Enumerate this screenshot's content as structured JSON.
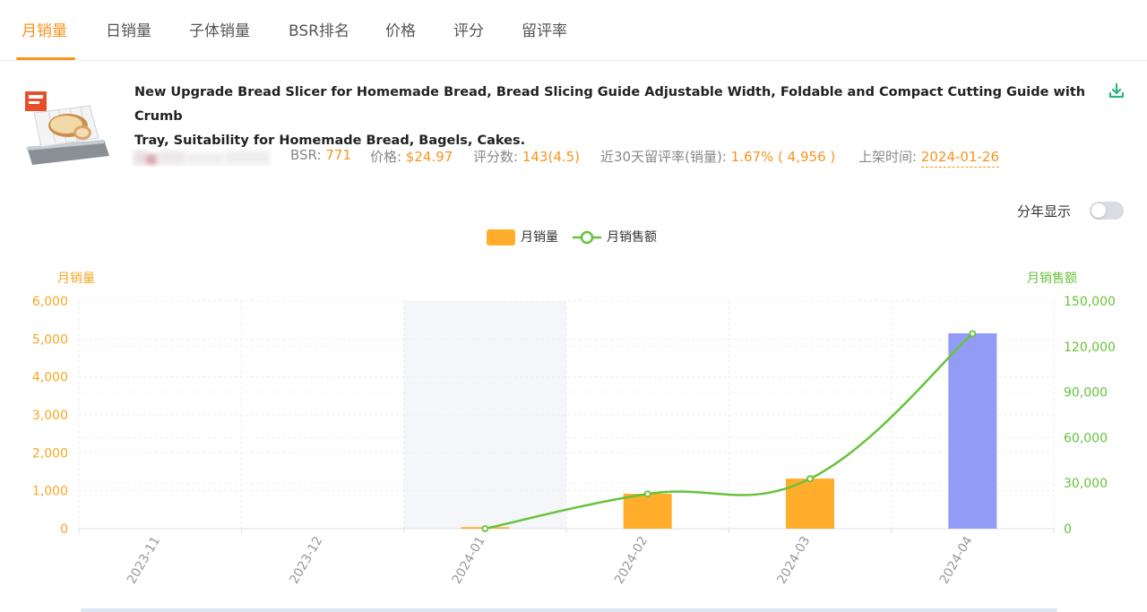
{
  "tabs": [
    {
      "label": "月销量",
      "active": true
    },
    {
      "label": "日销量",
      "active": false
    },
    {
      "label": "子体销量",
      "active": false
    },
    {
      "label": "BSR排名",
      "active": false
    },
    {
      "label": "价格",
      "active": false
    },
    {
      "label": "评分",
      "active": false
    },
    {
      "label": "留评率",
      "active": false
    }
  ],
  "product": {
    "title_line1": "New Upgrade Bread Slicer for Homemade Bread, Bread Slicing Guide Adjustable Width, Foldable and Compact Cutting Guide with Crumb",
    "title_line2": "Tray, Suitability for Homemade Bread, Bagels, Cakes.",
    "metrics": {
      "bsr_label": "BSR:",
      "bsr": "771",
      "price_label": "价格:",
      "price": "$24.97",
      "reviews_label": "评分数:",
      "reviews": "143(4.5)",
      "review_rate_label": "近30天留评率(销量):",
      "review_rate": "1.67% ( 4,956 )",
      "launch_label": "上架时间:",
      "launch_date": "2024-01-26"
    }
  },
  "controls": {
    "year_toggle_label": "分年显示",
    "year_toggle_on": false
  },
  "colors": {
    "accent": "#f7941d",
    "bar": "#ffad2a",
    "bar_highlight": "#929cf7",
    "line": "#67c23a",
    "left_axis": "#f5a623",
    "right_axis": "#67c23a"
  },
  "chart_data": {
    "type": "bar",
    "categories": [
      "2023-11",
      "2023-12",
      "2024-01",
      "2024-02",
      "2024-03",
      "2024-04"
    ],
    "highlighted_category": "2024-01",
    "series": [
      {
        "name": "月销量",
        "type": "bar",
        "axis": "left",
        "values": [
          null,
          null,
          40,
          920,
          1320,
          5150
        ],
        "highlighted_index": 5
      },
      {
        "name": "月销售额",
        "type": "line",
        "axis": "right",
        "values": [
          null,
          null,
          0,
          22900,
          32900,
          128500
        ]
      }
    ],
    "y_left": {
      "label": "月销量",
      "ylim": [
        0,
        6000
      ],
      "ticks": [
        "0",
        "1,000",
        "2,000",
        "3,000",
        "4,000",
        "5,000",
        "6,000"
      ]
    },
    "y_right": {
      "label": "月销售额",
      "ylim": [
        0,
        150000
      ],
      "ticks": [
        "0",
        "30,000",
        "60,000",
        "90,000",
        "120,000",
        "150,000"
      ]
    },
    "grid": true,
    "legend_position": "top-center"
  }
}
